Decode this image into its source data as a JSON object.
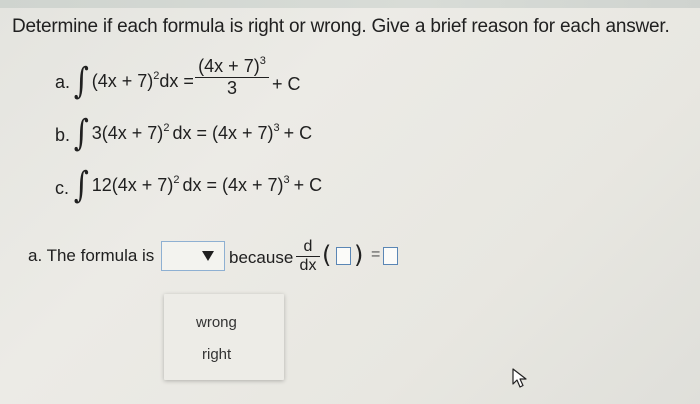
{
  "question": "Determine if each formula is right or wrong. Give a brief reason for each answer.",
  "items": [
    {
      "letter": "a.",
      "integrand": "(4x + 7)",
      "exp": "2",
      "dx_eq": "dx =",
      "numerator_base": "(4x + 7)",
      "numerator_exp": "3",
      "denominator": "3",
      "plus_c": "+ C"
    },
    {
      "letter": "b.",
      "integrand": "3(4x + 7)",
      "exp": "2",
      "rest": "dx = (4x + 7)",
      "rest_exp": "3",
      "plus_c": "+ C"
    },
    {
      "letter": "c.",
      "integrand": "12(4x + 7)",
      "exp": "2",
      "rest": "dx = (4x + 7)",
      "rest_exp": "3",
      "plus_c": "+ C"
    }
  ],
  "answer": {
    "label": "a. The formula is",
    "selected_value": "",
    "because": "because",
    "d_num": "d",
    "d_den": "dx",
    "equals": "=",
    "options": [
      "wrong",
      "right"
    ]
  }
}
